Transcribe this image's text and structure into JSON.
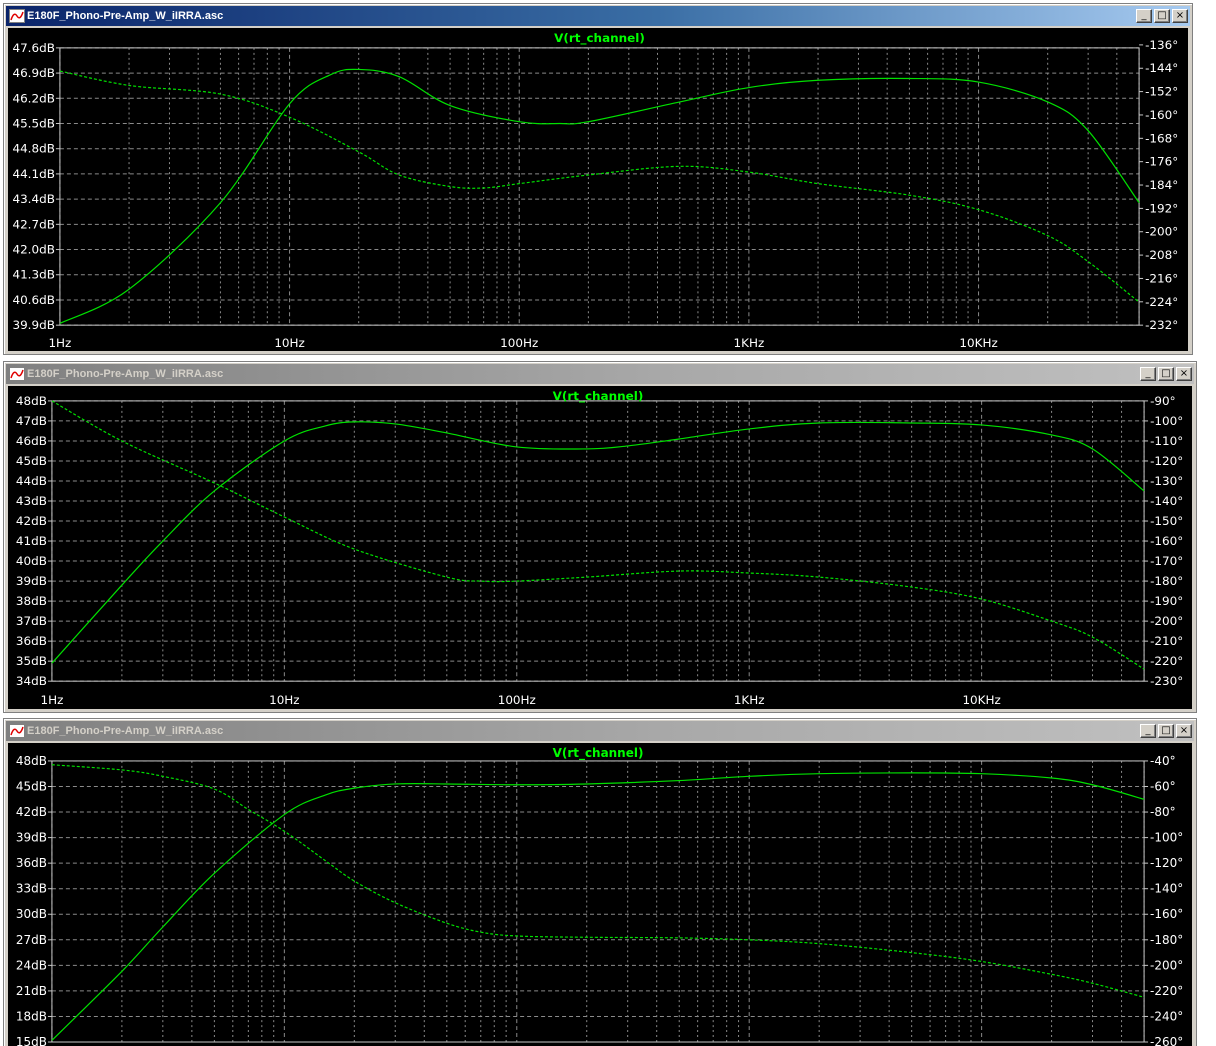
{
  "windows": [
    {
      "title": "E180F_Phono-Pre-Amp_W_iIRRA.asc",
      "active": true,
      "controls": {
        "minimize": "_",
        "maximize": "□",
        "close": "×"
      },
      "trace_name": "V(rt_channel)",
      "x_ticks": [
        "1Hz",
        "10Hz",
        "100Hz",
        "1KHz",
        "10KHz"
      ],
      "left_ticks": [
        "47.6dB",
        "46.9dB",
        "46.2dB",
        "45.5dB",
        "44.8dB",
        "44.1dB",
        "43.4dB",
        "42.7dB",
        "42.0dB",
        "41.3dB",
        "40.6dB",
        "39.9dB"
      ],
      "right_ticks": [
        "-136°",
        "-144°",
        "-152°",
        "-160°",
        "-168°",
        "-176°",
        "-184°",
        "-192°",
        "-200°",
        "-208°",
        "-216°",
        "-224°",
        "-232°"
      ]
    },
    {
      "title": "E180F_Phono-Pre-Amp_W_iIRRA.asc",
      "active": false,
      "controls": {
        "minimize": "_",
        "maximize": "□",
        "close": "×"
      },
      "trace_name": "V(rt_channel)",
      "x_ticks": [
        "1Hz",
        "10Hz",
        "100Hz",
        "1KHz",
        "10KHz"
      ],
      "left_ticks": [
        "48dB",
        "47dB",
        "46dB",
        "45dB",
        "44dB",
        "43dB",
        "42dB",
        "41dB",
        "40dB",
        "39dB",
        "38dB",
        "37dB",
        "36dB",
        "35dB",
        "34dB"
      ],
      "right_ticks": [
        "-90°",
        "-100°",
        "-110°",
        "-120°",
        "-130°",
        "-140°",
        "-150°",
        "-160°",
        "-170°",
        "-180°",
        "-190°",
        "-200°",
        "-210°",
        "-220°",
        "-230°"
      ]
    },
    {
      "title": "E180F_Phono-Pre-Amp_W_iIRRA.asc",
      "active": false,
      "controls": {
        "minimize": "_",
        "maximize": "□",
        "close": "×"
      },
      "trace_name": "V(rt_channel)",
      "x_ticks": [],
      "left_ticks": [
        "48dB",
        "45dB",
        "42dB",
        "39dB",
        "36dB",
        "33dB",
        "30dB",
        "27dB",
        "24dB",
        "21dB",
        "18dB",
        "15dB"
      ],
      "right_ticks": [
        "-40°",
        "-60°",
        "-80°",
        "-100°",
        "-120°",
        "-140°",
        "-160°",
        "-180°",
        "-200°",
        "-220°",
        "-240°",
        "-260°"
      ]
    }
  ],
  "chart_data": [
    {
      "type": "line",
      "title": "V(rt_channel)",
      "x_scale": "log",
      "x_range_hz": [
        1,
        50000
      ],
      "x_tick_values_hz": [
        1,
        10,
        100,
        1000,
        10000
      ],
      "y_left_range_db": [
        39.9,
        47.6
      ],
      "y_right_range_deg": [
        -232,
        -136
      ],
      "grid": true,
      "series": [
        {
          "style": "solid",
          "axis": "left",
          "x": [
            1,
            2,
            5,
            10,
            15,
            20,
            30,
            50,
            100,
            150,
            200,
            500,
            1000,
            2000,
            5000,
            10000,
            20000,
            30000,
            50000
          ],
          "y": [
            39.95,
            40.9,
            43.3,
            46.05,
            46.85,
            47.0,
            46.8,
            46.0,
            45.55,
            45.5,
            45.55,
            46.1,
            46.5,
            46.7,
            46.75,
            46.65,
            46.1,
            45.3,
            43.3
          ]
        },
        {
          "style": "dashed",
          "axis": "right",
          "x": [
            1,
            2,
            5,
            10,
            20,
            30,
            50,
            70,
            100,
            200,
            500,
            1000,
            2000,
            5000,
            10000,
            20000,
            30000,
            50000
          ],
          "y": [
            -144,
            -149,
            -152,
            -160,
            -172,
            -180,
            -184,
            -184.5,
            -183,
            -180,
            -177,
            -179,
            -183,
            -187,
            -192,
            -201,
            -210,
            -224
          ]
        }
      ]
    },
    {
      "type": "line",
      "title": "V(rt_channel)",
      "x_scale": "log",
      "x_range_hz": [
        1,
        50000
      ],
      "x_tick_values_hz": [
        1,
        10,
        100,
        1000,
        10000
      ],
      "y_left_range_db": [
        34,
        48
      ],
      "y_right_range_deg": [
        -230,
        -90
      ],
      "grid": true,
      "series": [
        {
          "style": "solid",
          "axis": "left",
          "x": [
            1,
            2,
            3,
            5,
            10,
            15,
            20,
            30,
            50,
            100,
            200,
            300,
            500,
            1000,
            2000,
            5000,
            10000,
            20000,
            30000,
            50000
          ],
          "y": [
            34.9,
            38.8,
            41.0,
            43.5,
            46.0,
            46.75,
            46.95,
            46.85,
            46.4,
            45.7,
            45.6,
            45.75,
            46.1,
            46.6,
            46.9,
            46.9,
            46.8,
            46.3,
            45.6,
            43.5
          ]
        },
        {
          "style": "dashed",
          "axis": "right",
          "x": [
            1,
            2,
            5,
            10,
            20,
            50,
            70,
            100,
            200,
            500,
            1000,
            2000,
            5000,
            10000,
            20000,
            30000,
            50000
          ],
          "y": [
            -90,
            -110,
            -131,
            -148,
            -164,
            -178,
            -180,
            -180,
            -178,
            -175,
            -176,
            -178,
            -183,
            -189,
            -200,
            -208,
            -224
          ]
        }
      ]
    },
    {
      "type": "line",
      "title": "V(rt_channel)",
      "x_scale": "log",
      "x_range_hz": [
        1,
        50000
      ],
      "y_left_range_db": [
        15,
        48
      ],
      "y_right_range_deg": [
        -260,
        -40
      ],
      "grid": true,
      "series": [
        {
          "style": "solid",
          "axis": "left",
          "x": [
            1,
            2,
            3,
            5,
            10,
            15,
            20,
            30,
            50,
            100,
            200,
            500,
            1000,
            2000,
            5000,
            10000,
            20000,
            30000,
            50000
          ],
          "y": [
            15.2,
            23.3,
            28.5,
            34.8,
            41.7,
            44.0,
            44.8,
            45.3,
            45.3,
            45.2,
            45.3,
            45.7,
            46.2,
            46.5,
            46.6,
            46.5,
            46.0,
            45.2,
            43.5
          ]
        },
        {
          "style": "dashed",
          "axis": "right",
          "x": [
            1,
            2,
            3,
            5,
            7,
            10,
            15,
            20,
            30,
            50,
            70,
            100,
            200,
            500,
            1000,
            2000,
            5000,
            10000,
            20000,
            30000,
            50000
          ],
          "y": [
            -43,
            -47,
            -52,
            -62,
            -78,
            -95,
            -118,
            -134,
            -151,
            -167,
            -174,
            -177,
            -178,
            -178.5,
            -180,
            -183,
            -190,
            -197,
            -207,
            -214,
            -225
          ]
        }
      ]
    }
  ]
}
